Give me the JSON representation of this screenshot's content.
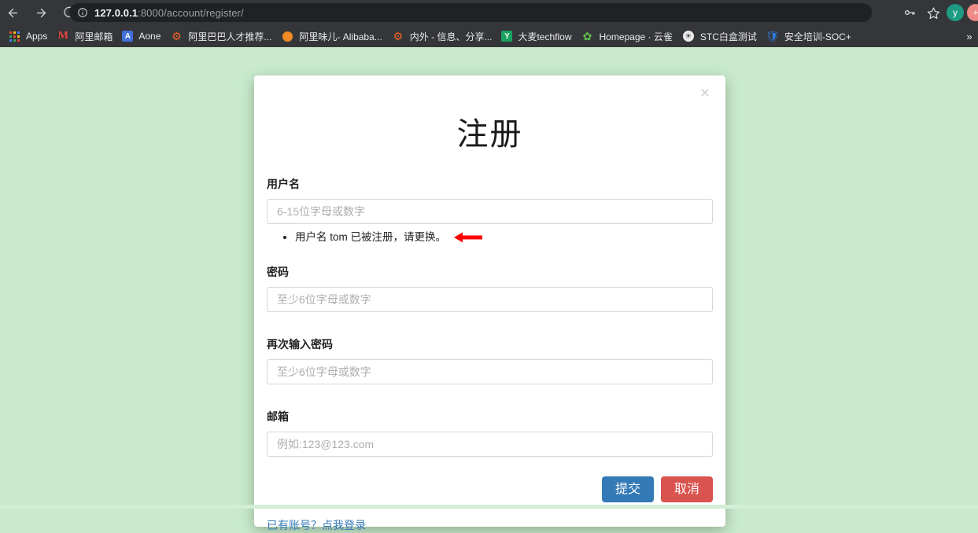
{
  "browser": {
    "nav": {
      "back_label": "back-arrow",
      "forward_label": "forward-arrow",
      "reload_label": "reload"
    },
    "omnibox": {
      "host": "127.0.0.1",
      "path": ":8000/account/register/",
      "full_url": "127.0.0.1:8000/account/register/",
      "info_icon": "site-information-icon"
    },
    "toolbar_right": {
      "key_icon": "key-icon",
      "star_icon": "star-bookmark-icon",
      "avatar_initial": "y",
      "avatar_secondary_glyph": "+"
    },
    "bookmarks": [
      {
        "label": "Apps",
        "icon": "apps-grid-icon"
      },
      {
        "label": "阿里邮箱",
        "icon": "mail-m-icon"
      },
      {
        "label": "Aone",
        "icon": "aone-a-icon"
      },
      {
        "label": "阿里巴巴人才推荐...",
        "icon": "gear-icon"
      },
      {
        "label": "阿里味儿- Alibaba...",
        "icon": "orange-fruit-icon"
      },
      {
        "label": "内外 - 信息、分享...",
        "icon": "gear-icon"
      },
      {
        "label": "大麦techflow",
        "icon": "y-square-icon"
      },
      {
        "label": "Homepage · 云雀",
        "icon": "leaf-icon"
      },
      {
        "label": "STC白盒测试",
        "icon": "globe-icon"
      },
      {
        "label": "安全培训-SOC+",
        "icon": "shield-icon"
      }
    ],
    "bookmarks_overflow": "»"
  },
  "modal": {
    "close_label": "×",
    "title": "注册",
    "fields": [
      {
        "label": "用户名",
        "placeholder": "6-15位字母或数字",
        "value": "",
        "type": "text",
        "name": "username"
      },
      {
        "label": "密码",
        "placeholder": "至少6位字母或数字",
        "value": "",
        "type": "password",
        "name": "password"
      },
      {
        "label": "再次输入密码",
        "placeholder": "至少6位字母或数字",
        "value": "",
        "type": "password",
        "name": "password-confirm"
      },
      {
        "label": "邮箱",
        "placeholder": "例如:123@123.com",
        "value": "",
        "type": "text",
        "name": "email"
      }
    ],
    "username_error": "用户名 tom 已被注册，请更换。",
    "annotation": {
      "shape": "left-arrow",
      "color": "#fe0000"
    },
    "submit_label": "提交",
    "cancel_label": "取消",
    "login_link": "已有账号？点我登录"
  },
  "colors": {
    "page_background": "#c9ebcc",
    "chrome_background": "#35363a",
    "omnibox_background": "#202124",
    "submit_button": "#337ab7",
    "cancel_button": "#d9534f",
    "link": "#337ab7",
    "annotation_arrow": "#fe0000"
  }
}
